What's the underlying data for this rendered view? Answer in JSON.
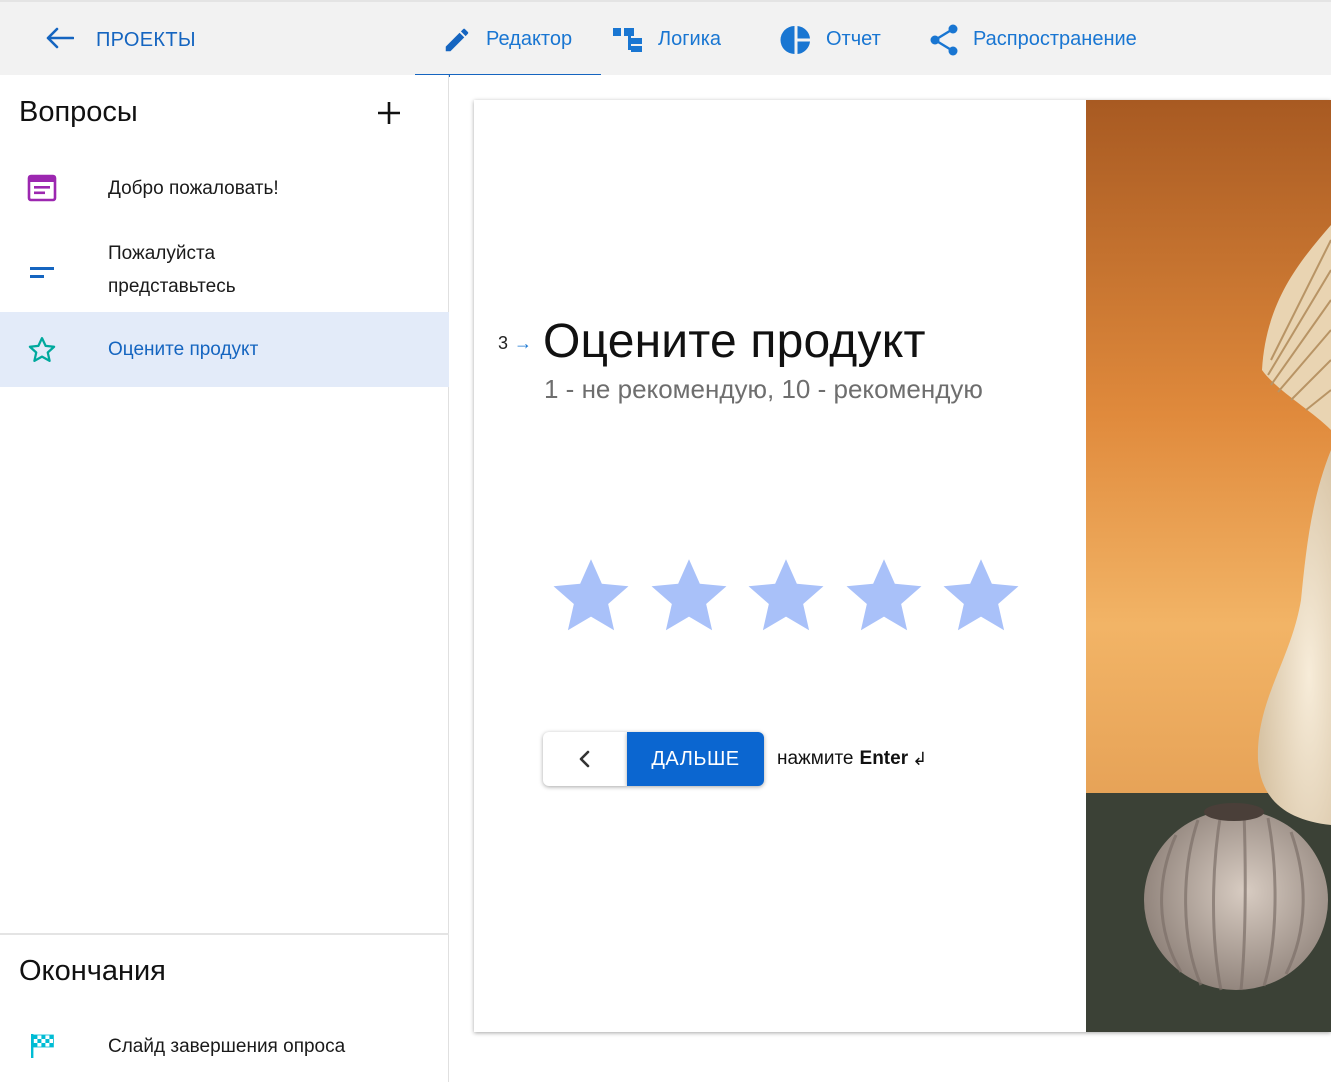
{
  "topbar": {
    "back_label": "ПРОЕКТЫ",
    "tabs": [
      {
        "label": "Редактор",
        "icon": "pencil-icon",
        "active": true
      },
      {
        "label": "Логика",
        "icon": "logic-tree-icon",
        "active": false
      },
      {
        "label": "Отчет",
        "icon": "pie-chart-icon",
        "active": false
      },
      {
        "label": "Распространение",
        "icon": "share-icon",
        "active": false
      }
    ]
  },
  "sidebar": {
    "questions_title": "Вопросы",
    "questions": [
      {
        "label": "Добро пожаловать!",
        "icon": "welcome-screen-icon",
        "icon_color": "#9c27b0"
      },
      {
        "label_line1": "Пожалуйста",
        "label_line2": "представьтесь",
        "icon": "short-text-icon",
        "icon_color": "#1565c0"
      },
      {
        "label": "Оцените продукт",
        "icon": "star-outline-icon",
        "icon_color": "#00a99d",
        "selected": true
      }
    ],
    "endings_title": "Окончания",
    "endings": [
      {
        "label": "Слайд завершения опроса",
        "icon": "checkered-flag-icon",
        "icon_color": "#00bcd4"
      }
    ]
  },
  "question": {
    "number": "3",
    "arrow": "→",
    "title": "Оцените продукт",
    "subtitle": "1 - не рекомендую, 10 - рекомендую",
    "rating_max": 5,
    "star_color": "#a9c1f9",
    "next_label": "ДАЛЬШЕ",
    "hint_prefix": "нажмите",
    "hint_key": "Enter",
    "hint_symbol": "↲"
  },
  "colors": {
    "accent": "#1565c0",
    "button": "#0b66d0",
    "selected_bg": "#e3ebf9",
    "topbar_bg": "#f2f2f2"
  }
}
